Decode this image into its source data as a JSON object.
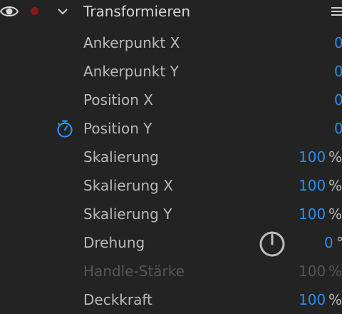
{
  "header": {
    "title": "Transformieren",
    "icons": {
      "visibility": "eye-icon",
      "record": "record-dot-icon",
      "collapse": "chevron-down-icon",
      "menu": "hamburger-menu-icon"
    },
    "record_color": "#8a1a1a"
  },
  "colors": {
    "value": "#2d8ceb",
    "label": "#b9b9b9",
    "disabled": "#565656",
    "background": "#232323"
  },
  "properties": [
    {
      "label": "Ankerpunkt X",
      "value": "0",
      "unit": ""
    },
    {
      "label": "Ankerpunkt Y",
      "value": "0",
      "unit": ""
    },
    {
      "label": "Position X",
      "value": "0",
      "unit": ""
    },
    {
      "label": "Position Y",
      "value": "0",
      "unit": "",
      "icon": "stopwatch-icon"
    },
    {
      "label": "Skalierung",
      "value": "100",
      "unit": "%"
    },
    {
      "label": "Skalierung X",
      "value": "100",
      "unit": "%"
    },
    {
      "label": "Skalierung Y",
      "value": "100",
      "unit": "%"
    },
    {
      "label": "Drehung",
      "value": "0",
      "unit": "°",
      "icon": "rotation-dial-icon"
    },
    {
      "label": "Handle-Stärke",
      "value": "100",
      "unit": "%",
      "disabled": true
    },
    {
      "label": "Deckkraft",
      "value": "100",
      "unit": "%"
    }
  ]
}
